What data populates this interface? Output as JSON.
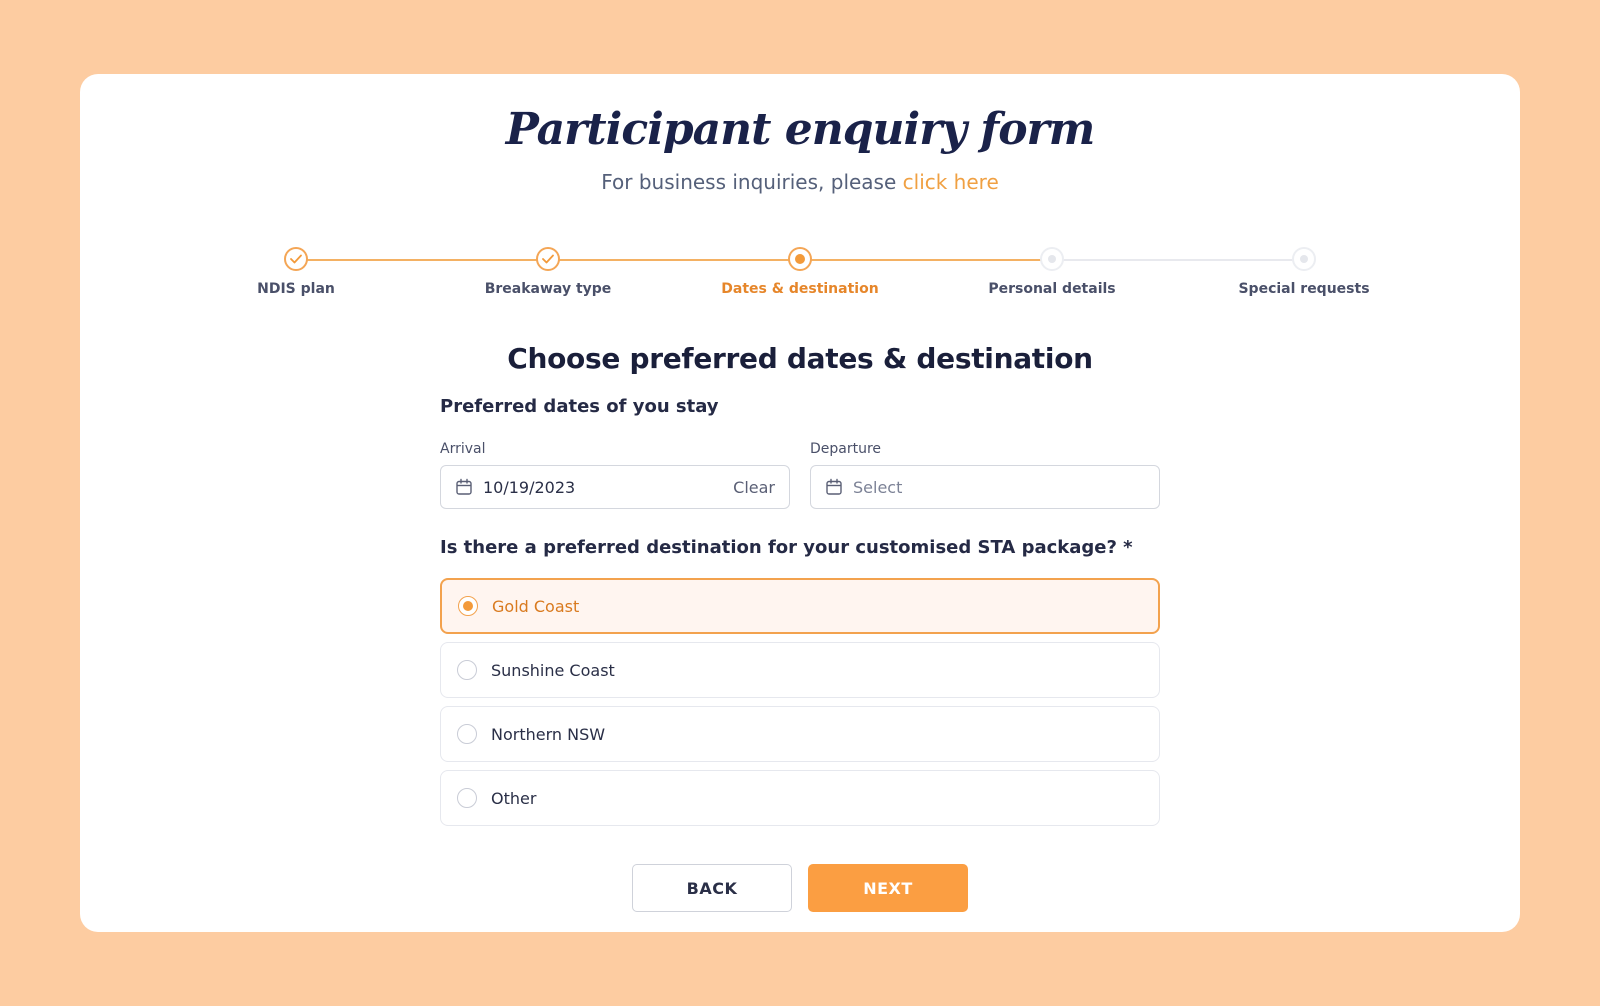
{
  "header": {
    "title": "Participant enquiry form",
    "subtitle_prefix": "For business inquiries, please ",
    "subtitle_link": "click here"
  },
  "stepper": {
    "steps": [
      {
        "label": "NDIS plan",
        "state": "done"
      },
      {
        "label": "Breakaway type",
        "state": "done"
      },
      {
        "label": "Dates & destination",
        "state": "active"
      },
      {
        "label": "Personal details",
        "state": "todo"
      },
      {
        "label": "Special requests",
        "state": "todo"
      }
    ]
  },
  "section": {
    "title": "Choose preferred dates & destination"
  },
  "dates": {
    "question": "Preferred dates of you stay",
    "arrival_label": "Arrival",
    "arrival_value": "10/19/2023",
    "clear_label": "Clear",
    "departure_label": "Departure",
    "departure_placeholder": "Select"
  },
  "destination": {
    "question": "Is there a preferred destination for your customised STA package? *",
    "options": [
      {
        "label": "Gold Coast",
        "selected": true
      },
      {
        "label": "Sunshine Coast",
        "selected": false
      },
      {
        "label": "Northern NSW",
        "selected": false
      },
      {
        "label": "Other",
        "selected": false
      }
    ]
  },
  "actions": {
    "back_label": "BACK",
    "next_label": "NEXT"
  },
  "colors": {
    "background": "#fdcca1",
    "accent": "#fb9e42",
    "title": "#1a2249"
  }
}
